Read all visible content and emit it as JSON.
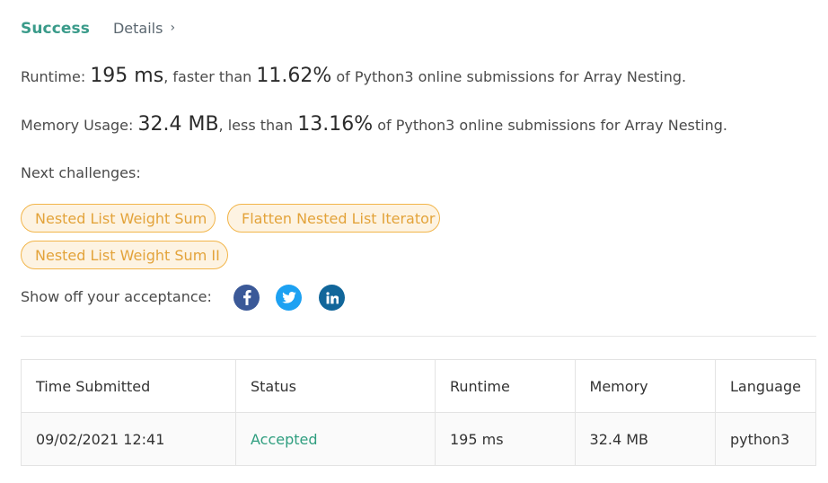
{
  "tabs": {
    "success": "Success",
    "details": "Details",
    "details_chevron": "›"
  },
  "runtime": {
    "label": "Runtime: ",
    "value": "195 ms",
    "comparison": ", faster than ",
    "percent": "11.62%",
    "suffix": " of Python3 online submissions for Array Nesting."
  },
  "memory": {
    "label": "Memory Usage: ",
    "value": "32.4 MB",
    "comparison": ", less than ",
    "percent": "13.16%",
    "suffix": " of Python3 online submissions for Array Nesting."
  },
  "next_challenges": {
    "label": "Next challenges:",
    "items": [
      "Nested List Weight Sum",
      "Flatten Nested List Iterator",
      "Nested List Weight Sum II"
    ]
  },
  "share": {
    "label": "Show off your acceptance:",
    "icons": [
      "facebook-icon",
      "twitter-icon",
      "linkedin-icon"
    ],
    "colors": {
      "facebook": "#3b5998",
      "twitter": "#1da1f2",
      "linkedin": "#11669a"
    }
  },
  "table": {
    "headers": [
      "Time Submitted",
      "Status",
      "Runtime",
      "Memory",
      "Language"
    ],
    "rows": [
      [
        "09/02/2021 12:41",
        "Accepted",
        "195 ms",
        "32.4 MB",
        "python3"
      ]
    ]
  },
  "colors": {
    "success": "#3a9b8a",
    "accepted": "#2f9e7f",
    "chip_border": "#f2b54a",
    "chip_bg": "#fdf3e2",
    "chip_text": "#e3a33a"
  }
}
